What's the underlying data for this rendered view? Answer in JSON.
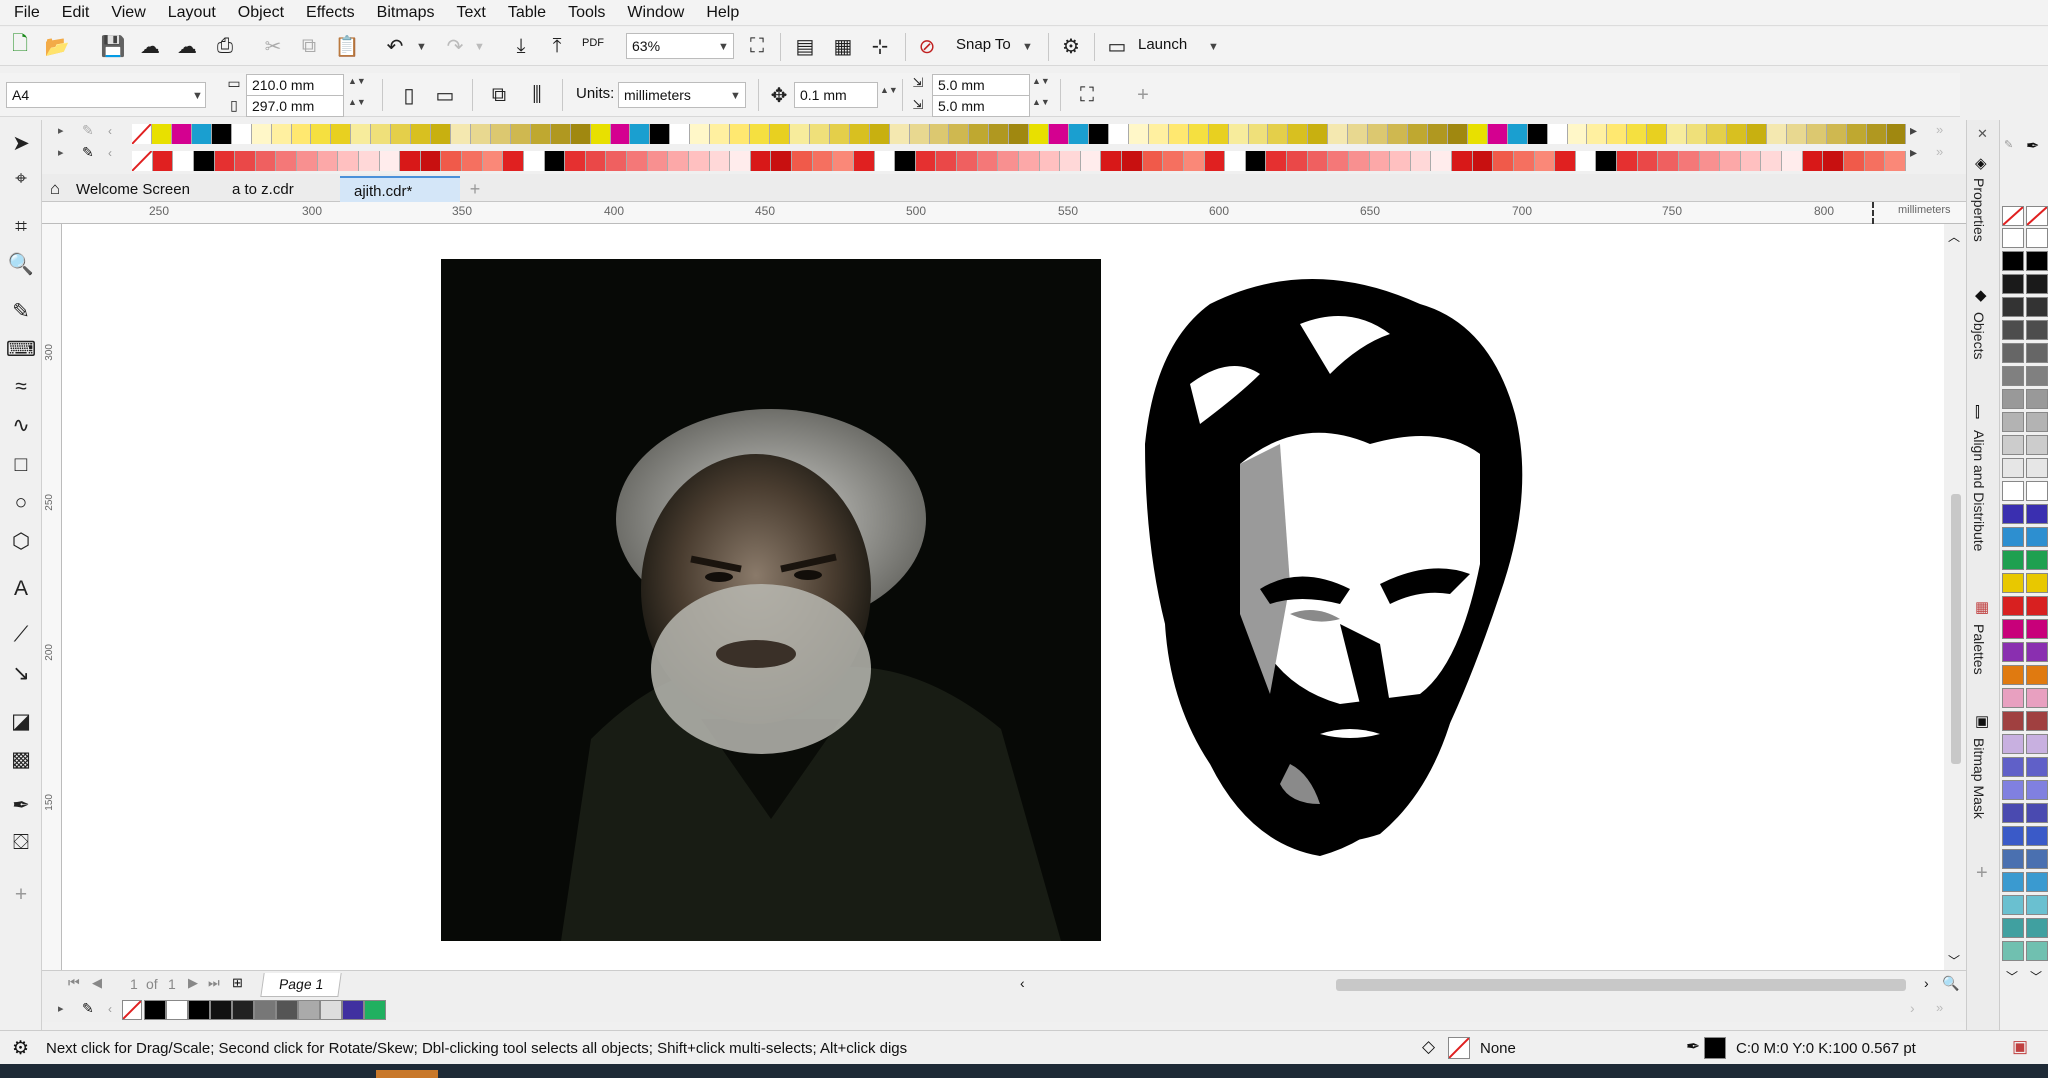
{
  "menu": [
    "File",
    "Edit",
    "View",
    "Layout",
    "Object",
    "Effects",
    "Bitmaps",
    "Text",
    "Table",
    "Tools",
    "Window",
    "Help"
  ],
  "toolbar": {
    "zoom": "63%",
    "snap_label": "Snap To",
    "launch_label": "Launch",
    "pdf_label": "PDF"
  },
  "propbar": {
    "page_size": "A4",
    "width": "210.0 mm",
    "height": "297.0 mm",
    "units_label": "Units:",
    "units_value": "millimeters",
    "nudge": "0.1 mm",
    "dup_x": "5.0 mm",
    "dup_y": "5.0 mm"
  },
  "tabs": [
    "Welcome Screen",
    "a to z.cdr",
    "ajith.cdr*"
  ],
  "ruler": {
    "ticks": [
      "250",
      "300",
      "350",
      "400",
      "450",
      "500",
      "550",
      "600",
      "650",
      "700",
      "750",
      "800"
    ],
    "unit": "millimeters",
    "vticks": [
      "300",
      "250",
      "200",
      "150"
    ]
  },
  "dock_tabs": [
    "Properties",
    "Objects",
    "Align and Distribute",
    "Palettes",
    "Bitmap Mask"
  ],
  "pagebar": {
    "page_of": "1",
    "of_label": "of",
    "total": "1",
    "page_tab": "Page 1"
  },
  "status": {
    "hint": "Next click for Drag/Scale; Second click for Rotate/Skew; Dbl-clicking tool selects all objects; Shift+click multi-selects; Alt+click digs",
    "fill_label": "None",
    "outline_info": "C:0 M:0 Y:0 K:100  0.567 pt"
  },
  "colors": {
    "palette_yellow": [
      "#e8e000",
      "#d40090",
      "#1a9fd0",
      "#000000",
      "#ffffff",
      "#fff7c8",
      "#fff0a0",
      "#ffe870",
      "#f5e040",
      "#e8d020",
      "#f7ec9c",
      "#efe07a",
      "#e4cf4a",
      "#d8c020",
      "#c8b010",
      "#f4e8b0",
      "#e8d890",
      "#dcc870",
      "#cfb850",
      "#bfa830",
      "#b09820",
      "#a08810"
    ],
    "palette_red": [
      "#e02020",
      "#ffffff",
      "#000000",
      "#e53030",
      "#ea4848",
      "#ef6060",
      "#f47878",
      "#f89090",
      "#fca8a8",
      "#ffc0c0",
      "#ffd8d8",
      "#ffecec",
      "#d81818",
      "#c81010",
      "#f05a4a",
      "#f57060",
      "#fa8878"
    ],
    "doc_palette": [
      "#000000",
      "#ffffff",
      "#000000",
      "#111111",
      "#222222",
      "#777777",
      "#555555",
      "#aaaaaa",
      "#dddddd",
      "#4030a0",
      "#20b060"
    ],
    "right_swatches": [
      "#ffffff",
      "#000000",
      "#1a1a1a",
      "#333333",
      "#4d4d4d",
      "#666666",
      "#808080",
      "#999999",
      "#b3b3b3",
      "#cccccc",
      "#e6e6e6",
      "#ffffff",
      "#3a2fb0",
      "#2d8fd0",
      "#1fa050",
      "#e8c800",
      "#d82020",
      "#c8007a",
      "#8a2fb0",
      "#e07a10",
      "#e8a0c0",
      "#a04040",
      "#c8b0e0",
      "#6060c8",
      "#8080e0",
      "#4a4ab0",
      "#3a5ac8",
      "#4a70b0",
      "#3a9ad0",
      "#6ac0d0",
      "#40a0a0",
      "#70c0b0"
    ]
  }
}
